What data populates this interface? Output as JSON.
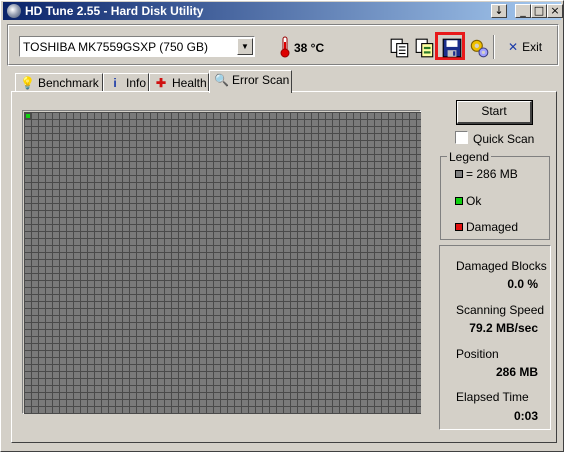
{
  "window": {
    "title": "HD Tune 2.55 - Hard Disk Utility",
    "title_buttons": [
      "↓",
      "_",
      "□",
      "×"
    ]
  },
  "toolbar": {
    "drive": "TOSHIBA MK7559GSXP (750 GB)",
    "temperature": "38 °C",
    "icons": [
      "copy-icon",
      "copy-all-icon",
      "save-icon",
      "options-icon"
    ],
    "exit_label": "Exit"
  },
  "tabs": [
    {
      "label": "Benchmark",
      "icon": "benchmark-icon"
    },
    {
      "label": "Info",
      "icon": "info-icon"
    },
    {
      "label": "Health",
      "icon": "health-icon"
    },
    {
      "label": "Error Scan",
      "icon": "magnifier-icon",
      "active": true
    }
  ],
  "scan": {
    "start_label": "Start",
    "quick_scan_label": "Quick Scan",
    "quick_scan_checked": false
  },
  "legend": {
    "title": "Legend",
    "items": [
      {
        "label": "= 286 MB",
        "color": "#808080"
      },
      {
        "label": "Ok",
        "color": "#10d010"
      },
      {
        "label": "Damaged",
        "color": "#e01010"
      }
    ]
  },
  "stats": {
    "damaged_blocks_label": "Damaged Blocks",
    "damaged_blocks_value": "0.0 %",
    "scanning_speed_label": "Scanning Speed",
    "scanning_speed_value": "79.2 MB/sec",
    "position_label": "Position",
    "position_value": "286 MB",
    "elapsed_time_label": "Elapsed Time",
    "elapsed_time_value": "0:03"
  },
  "colors": {
    "title_gradient_start": "#0a246a",
    "title_gradient_end": "#a6caf0",
    "block_grey": "#7a7a7a",
    "block_ok": "#10d010",
    "highlight": "#e8191a"
  }
}
